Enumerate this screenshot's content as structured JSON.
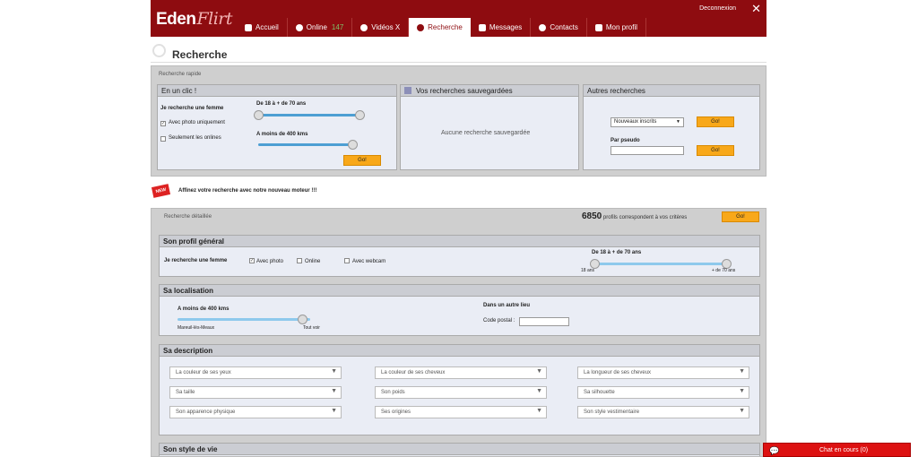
{
  "header": {
    "logo_main": "Eden",
    "logo_script": "Flirt",
    "logout": "Deconnexion",
    "nav": [
      {
        "label": "Accueil",
        "icon": "home-icon"
      },
      {
        "label": "Online",
        "count": "147",
        "icon": "chat-bubble-icon"
      },
      {
        "label": "Vidéos X",
        "icon": "play-icon"
      },
      {
        "label": "Recherche",
        "icon": "search-icon",
        "active": true
      },
      {
        "label": "Messages",
        "icon": "envelope-icon"
      },
      {
        "label": "Contacts",
        "icon": "person-icon"
      },
      {
        "label": "Mon profil",
        "icon": "profile-card-icon"
      }
    ]
  },
  "page_title": "Recherche",
  "quick": {
    "label": "Recherche rapide",
    "one_click": {
      "title": "En un clic !",
      "looking": "Je recherche une femme",
      "photo": "Avec photo uniquement",
      "online": "Seulement les onlines",
      "age": "De 18 à + de 70 ans",
      "distance": "A moins de 400 kms",
      "go": "Go!"
    },
    "saved": {
      "title": "Vos recherches sauvegardées",
      "empty": "Aucune recherche sauvegardée"
    },
    "other": {
      "title": "Autres recherches",
      "select": "Nouveaux inscrits",
      "go1": "Go!",
      "pseudo": "Par pseudo",
      "go2": "Go!"
    }
  },
  "banner": {
    "badge": "NEW",
    "text": "Affinez votre recherche avec notre nouveau moteur !!!"
  },
  "detailed": {
    "label": "Recherche détaillée",
    "count": "6850",
    "count_text": "profils correspondent à vos critères",
    "go": "Go!",
    "profile": {
      "title": "Son profil général",
      "looking": "Je recherche une femme",
      "photo": "Avec photo",
      "online": "Online",
      "webcam": "Avec webcam",
      "age": "De 18 à + de 70 ans",
      "min": "18 ans",
      "max": "+ de 70 ans"
    },
    "location": {
      "title": "Sa localisation",
      "distance": "A moins de 400 kms",
      "city": "Mareuil-lès-Meaux",
      "all": "Tout voir",
      "other_place": "Dans un autre lieu",
      "postal": "Code postal :"
    },
    "description": {
      "title": "Sa description",
      "fields": [
        "La couleur de ses yeux",
        "La couleur de ses cheveux",
        "La longueur de ses cheveux",
        "Sa taille",
        "Son poids",
        "Sa silhouette",
        "Son apparence physique",
        "Ses origines",
        "Son style vestimentaire"
      ]
    },
    "style": {
      "title": "Son style de vie"
    }
  },
  "chat": {
    "label": "Chat en cours",
    "count": "(0)"
  }
}
